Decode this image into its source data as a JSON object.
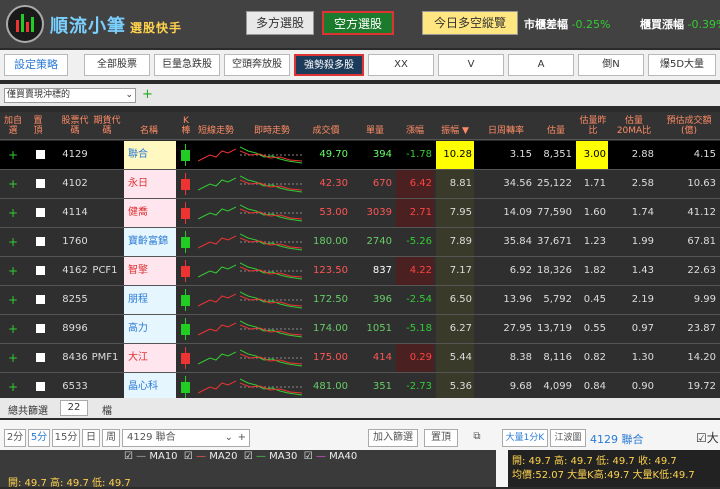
{
  "app": {
    "title": "順流小筆",
    "subtitle": "選股快手"
  },
  "tabs_top": {
    "long": "多方選股",
    "short": "空方選股",
    "today": "今日多空縱覽"
  },
  "kpi": {
    "label1": "市櫃差幅",
    "val1": "-0.25%",
    "label2": "櫃買漲幅",
    "val2": "-0.39%"
  },
  "strategy_btn": "設定策略",
  "filters": [
    "全部股票",
    "巨量急跌股",
    "空頭奔放股",
    "強勢殺多股",
    "XX",
    "V",
    "A",
    "倒N",
    "爆5D大量"
  ],
  "dropdown": "僅買賣現沖標的",
  "headers": [
    "加自選",
    "置頂",
    "股票代碼",
    "期貨代碼",
    "名稱",
    "K棒",
    "短線走勢",
    "即時走勢",
    "成交價",
    "單量",
    "漲幅",
    "振幅",
    "日周轉率",
    "估量",
    "估量昨比",
    "估量20MA比",
    "預估成交額(億)"
  ],
  "rows": [
    {
      "code": "4129",
      "fut": "",
      "name": "聯合",
      "price": "49.70",
      "vol": "394",
      "chg": "-1.78",
      "amp": "10.28",
      "turn": "3.15",
      "est": "8,351",
      "r1": "3.00",
      "r2": "2.88",
      "amt": "4.15"
    },
    {
      "code": "4102",
      "fut": "",
      "name": "永日",
      "price": "42.30",
      "vol": "670",
      "chg": "6.42",
      "amp": "8.81",
      "turn": "34.56",
      "est": "25,122",
      "r1": "1.71",
      "r2": "2.58",
      "amt": "10.63"
    },
    {
      "code": "4114",
      "fut": "",
      "name": "健喬",
      "price": "53.00",
      "vol": "3039",
      "chg": "2.71",
      "amp": "7.95",
      "turn": "14.09",
      "est": "77,590",
      "r1": "1.60",
      "r2": "1.74",
      "amt": "41.12"
    },
    {
      "code": "1760",
      "fut": "",
      "name": "寶齡富錦",
      "price": "180.00",
      "vol": "2740",
      "chg": "-5.26",
      "amp": "7.89",
      "turn": "35.84",
      "est": "37,671",
      "r1": "1.23",
      "r2": "1.99",
      "amt": "67.81"
    },
    {
      "code": "4162",
      "fut": "PCF1",
      "name": "智擎",
      "price": "123.50",
      "vol": "837",
      "chg": "4.22",
      "amp": "7.17",
      "turn": "6.92",
      "est": "18,326",
      "r1": "1.82",
      "r2": "1.43",
      "amt": "22.63"
    },
    {
      "code": "8255",
      "fut": "",
      "name": "朋程",
      "price": "172.50",
      "vol": "396",
      "chg": "-2.54",
      "amp": "6.50",
      "turn": "13.96",
      "est": "5,792",
      "r1": "0.45",
      "r2": "2.19",
      "amt": "9.99"
    },
    {
      "code": "8996",
      "fut": "",
      "name": "高力",
      "price": "174.00",
      "vol": "1051",
      "chg": "-5.18",
      "amp": "6.27",
      "turn": "27.95",
      "est": "13,719",
      "r1": "0.55",
      "r2": "0.97",
      "amt": "23.87"
    },
    {
      "code": "8436",
      "fut": "PMF1",
      "name": "大江",
      "price": "175.00",
      "vol": "414",
      "chg": "0.29",
      "amp": "5.44",
      "turn": "8.38",
      "est": "8,116",
      "r1": "0.82",
      "r2": "1.30",
      "amt": "14.20"
    },
    {
      "code": "6533",
      "fut": "",
      "name": "晶心科",
      "price": "481.00",
      "vol": "351",
      "chg": "-2.73",
      "amp": "5.36",
      "turn": "9.68",
      "est": "4,099",
      "r1": "0.84",
      "r2": "0.90",
      "amt": "19.72"
    }
  ],
  "footer": {
    "label": "總共篩選",
    "count": "22",
    "unit": "檔"
  },
  "bottom": {
    "periods": [
      "2分",
      "5分",
      "15分",
      "日",
      "周"
    ],
    "stock": "4129 聯合",
    "add": "加入篩選",
    "pin": "置頂",
    "ma": [
      "MA10",
      "MA20",
      "MA30",
      "MA40"
    ],
    "ohlc": "開: 49.7   高: 49.7   低: 49.7",
    "rtabs": [
      "大量1分K",
      "江波圖"
    ],
    "rstock": "4129 聯合",
    "rline1": "開: 49.7  高: 49.7  低: 49.7  收: 49.7",
    "rline2": "均價:52.07  大量K高:49.7  大量K低:49.7"
  }
}
